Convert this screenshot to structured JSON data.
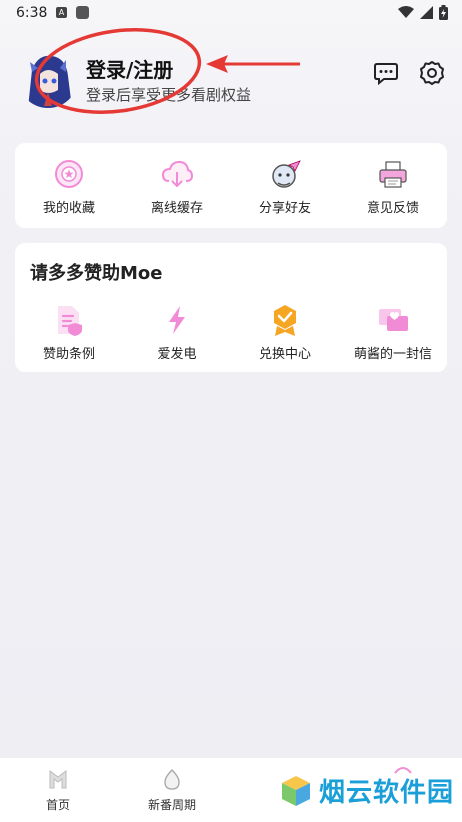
{
  "status": {
    "time": "6:38",
    "a_glyph": "A"
  },
  "header": {
    "login_title": "登录/注册",
    "login_subtitle": "登录后享受更多看剧权益"
  },
  "quick_actions": [
    {
      "label": "我的收藏",
      "icon": "favorites-icon"
    },
    {
      "label": "离线缓存",
      "icon": "cloud-download-icon"
    },
    {
      "label": "分享好友",
      "icon": "share-icon"
    },
    {
      "label": "意见反馈",
      "icon": "feedback-printer-icon"
    }
  ],
  "sponsor": {
    "title": "请多多赞助Moe",
    "items": [
      {
        "label": "赞助条例",
        "icon": "document-shield-icon"
      },
      {
        "label": "爱发电",
        "icon": "lightning-icon"
      },
      {
        "label": "兑换中心",
        "icon": "badge-check-icon"
      },
      {
        "label": "萌酱的一封信",
        "icon": "letter-heart-icon"
      }
    ]
  },
  "tabs": [
    {
      "label": "首页",
      "icon": "home-icon"
    },
    {
      "label": "新番周期",
      "icon": "egg-icon"
    }
  ],
  "watermark": {
    "text": "烟云软件园"
  },
  "colors": {
    "accent_pink": "#f28bd6",
    "annotation_red": "#e53935",
    "badge_orange": "#f5a623",
    "watermark_blue": "#1a9fd8"
  }
}
